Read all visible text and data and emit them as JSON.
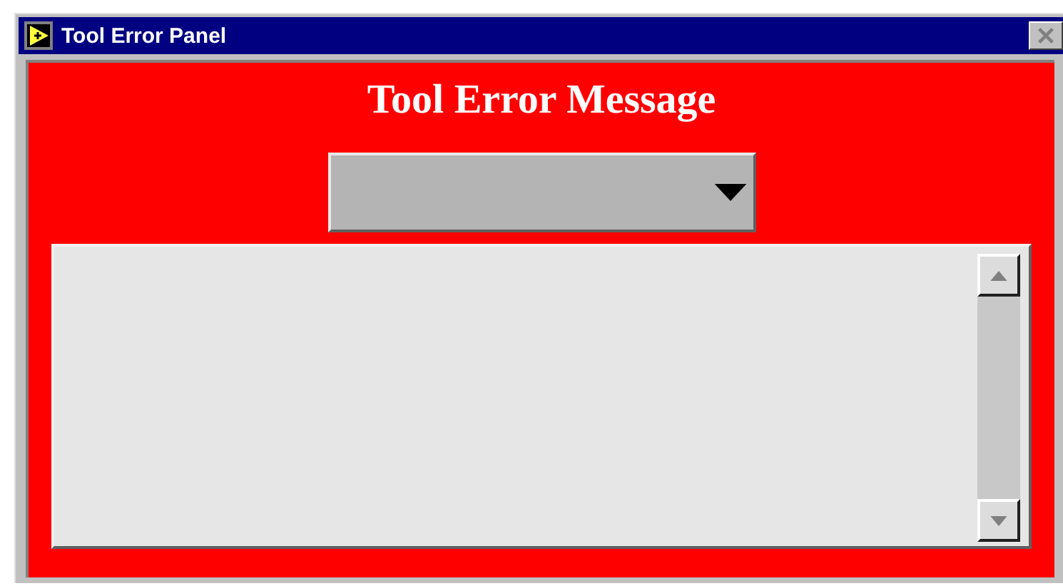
{
  "window": {
    "title": "Tool Error Panel"
  },
  "heading": "Tool Error Message"
}
